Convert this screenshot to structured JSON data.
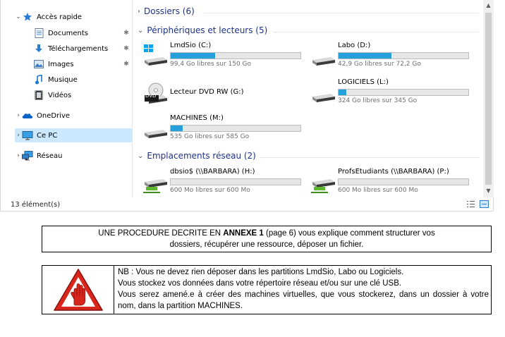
{
  "nav": {
    "quick_access": "Accès rapide",
    "items": [
      {
        "label": "Documents",
        "icon": "documents-icon",
        "pinned": true
      },
      {
        "label": "Téléchargements",
        "icon": "downloads-icon",
        "pinned": true
      },
      {
        "label": "Images",
        "icon": "images-icon",
        "pinned": true
      },
      {
        "label": "Musique",
        "icon": "music-icon",
        "pinned": false
      },
      {
        "label": "Vidéos",
        "icon": "videos-icon",
        "pinned": false
      }
    ],
    "onedrive": "OneDrive",
    "this_pc": "Ce PC",
    "network": "Réseau"
  },
  "groups": {
    "folders": "Dossiers (6)",
    "devices": "Périphériques et lecteurs (5)",
    "network": "Emplacements réseau (2)"
  },
  "drives": {
    "c": {
      "name": "LmdSio (C:)",
      "free": "99,4 Go libres sur 150 Go",
      "used_fraction": 0.34
    },
    "d": {
      "name": "Labo (D:)",
      "free": "42,9 Go libres sur 72,2 Go",
      "used_fraction": 0.41
    },
    "g": {
      "name": "Lecteur DVD RW (G:)",
      "badge": "DVD"
    },
    "l": {
      "name": "LOGICIELS (L:)",
      "free": "324 Go libres sur 345 Go",
      "used_fraction": 0.06
    },
    "m": {
      "name": "MACHINES (M:)",
      "free": "535 Go libres sur 585 Go",
      "used_fraction": 0.09
    },
    "h": {
      "name": "dbsio$ (\\\\BARBARA) (H:)",
      "free": "600 Mo libres sur 600 Mo",
      "used_fraction": 0.0
    },
    "p": {
      "name": "ProfsEtudiants (\\\\BARBARA) (P:)",
      "free": "600 Mo libres sur 600 Mo",
      "used_fraction": 0.0
    }
  },
  "status": {
    "count": "13 élément(s)"
  },
  "procedure": {
    "before": "UNE PROCEDURE DECRITE EN ",
    "bold": "ANNEXE 1",
    "after_line1": " (page 6) vous explique comment structurer vos",
    "line2": "dossiers, récupérer une ressource, déposer un fichier."
  },
  "nb": {
    "lines": [
      "NB : Vous ne devez rien déposer dans les partitions LmdSio, Labo ou Logiciels.",
      "Vous stockez vos données dans votre répertoire réseau et/ou sur une clé USB.",
      "Vous serez amené.e à créer des machines virtuelles, que vous stockerez, dans un dossier à votre nom, dans la partition MACHINES."
    ]
  },
  "colors": {
    "accent": "#26a0da",
    "group_header": "#1e3287",
    "selected": "#cce8ff",
    "stop_sign": "#d9261c"
  }
}
